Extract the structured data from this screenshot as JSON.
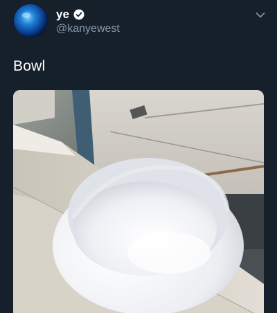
{
  "tweet": {
    "display_name": "ye",
    "handle": "@kanyewest",
    "text": "Bowl"
  },
  "icons": {
    "verified": "verified-badge-icon",
    "more": "chevron-down-icon"
  },
  "colors": {
    "background": "#15202b",
    "handle": "#8899a6",
    "text": "#ffffff"
  }
}
